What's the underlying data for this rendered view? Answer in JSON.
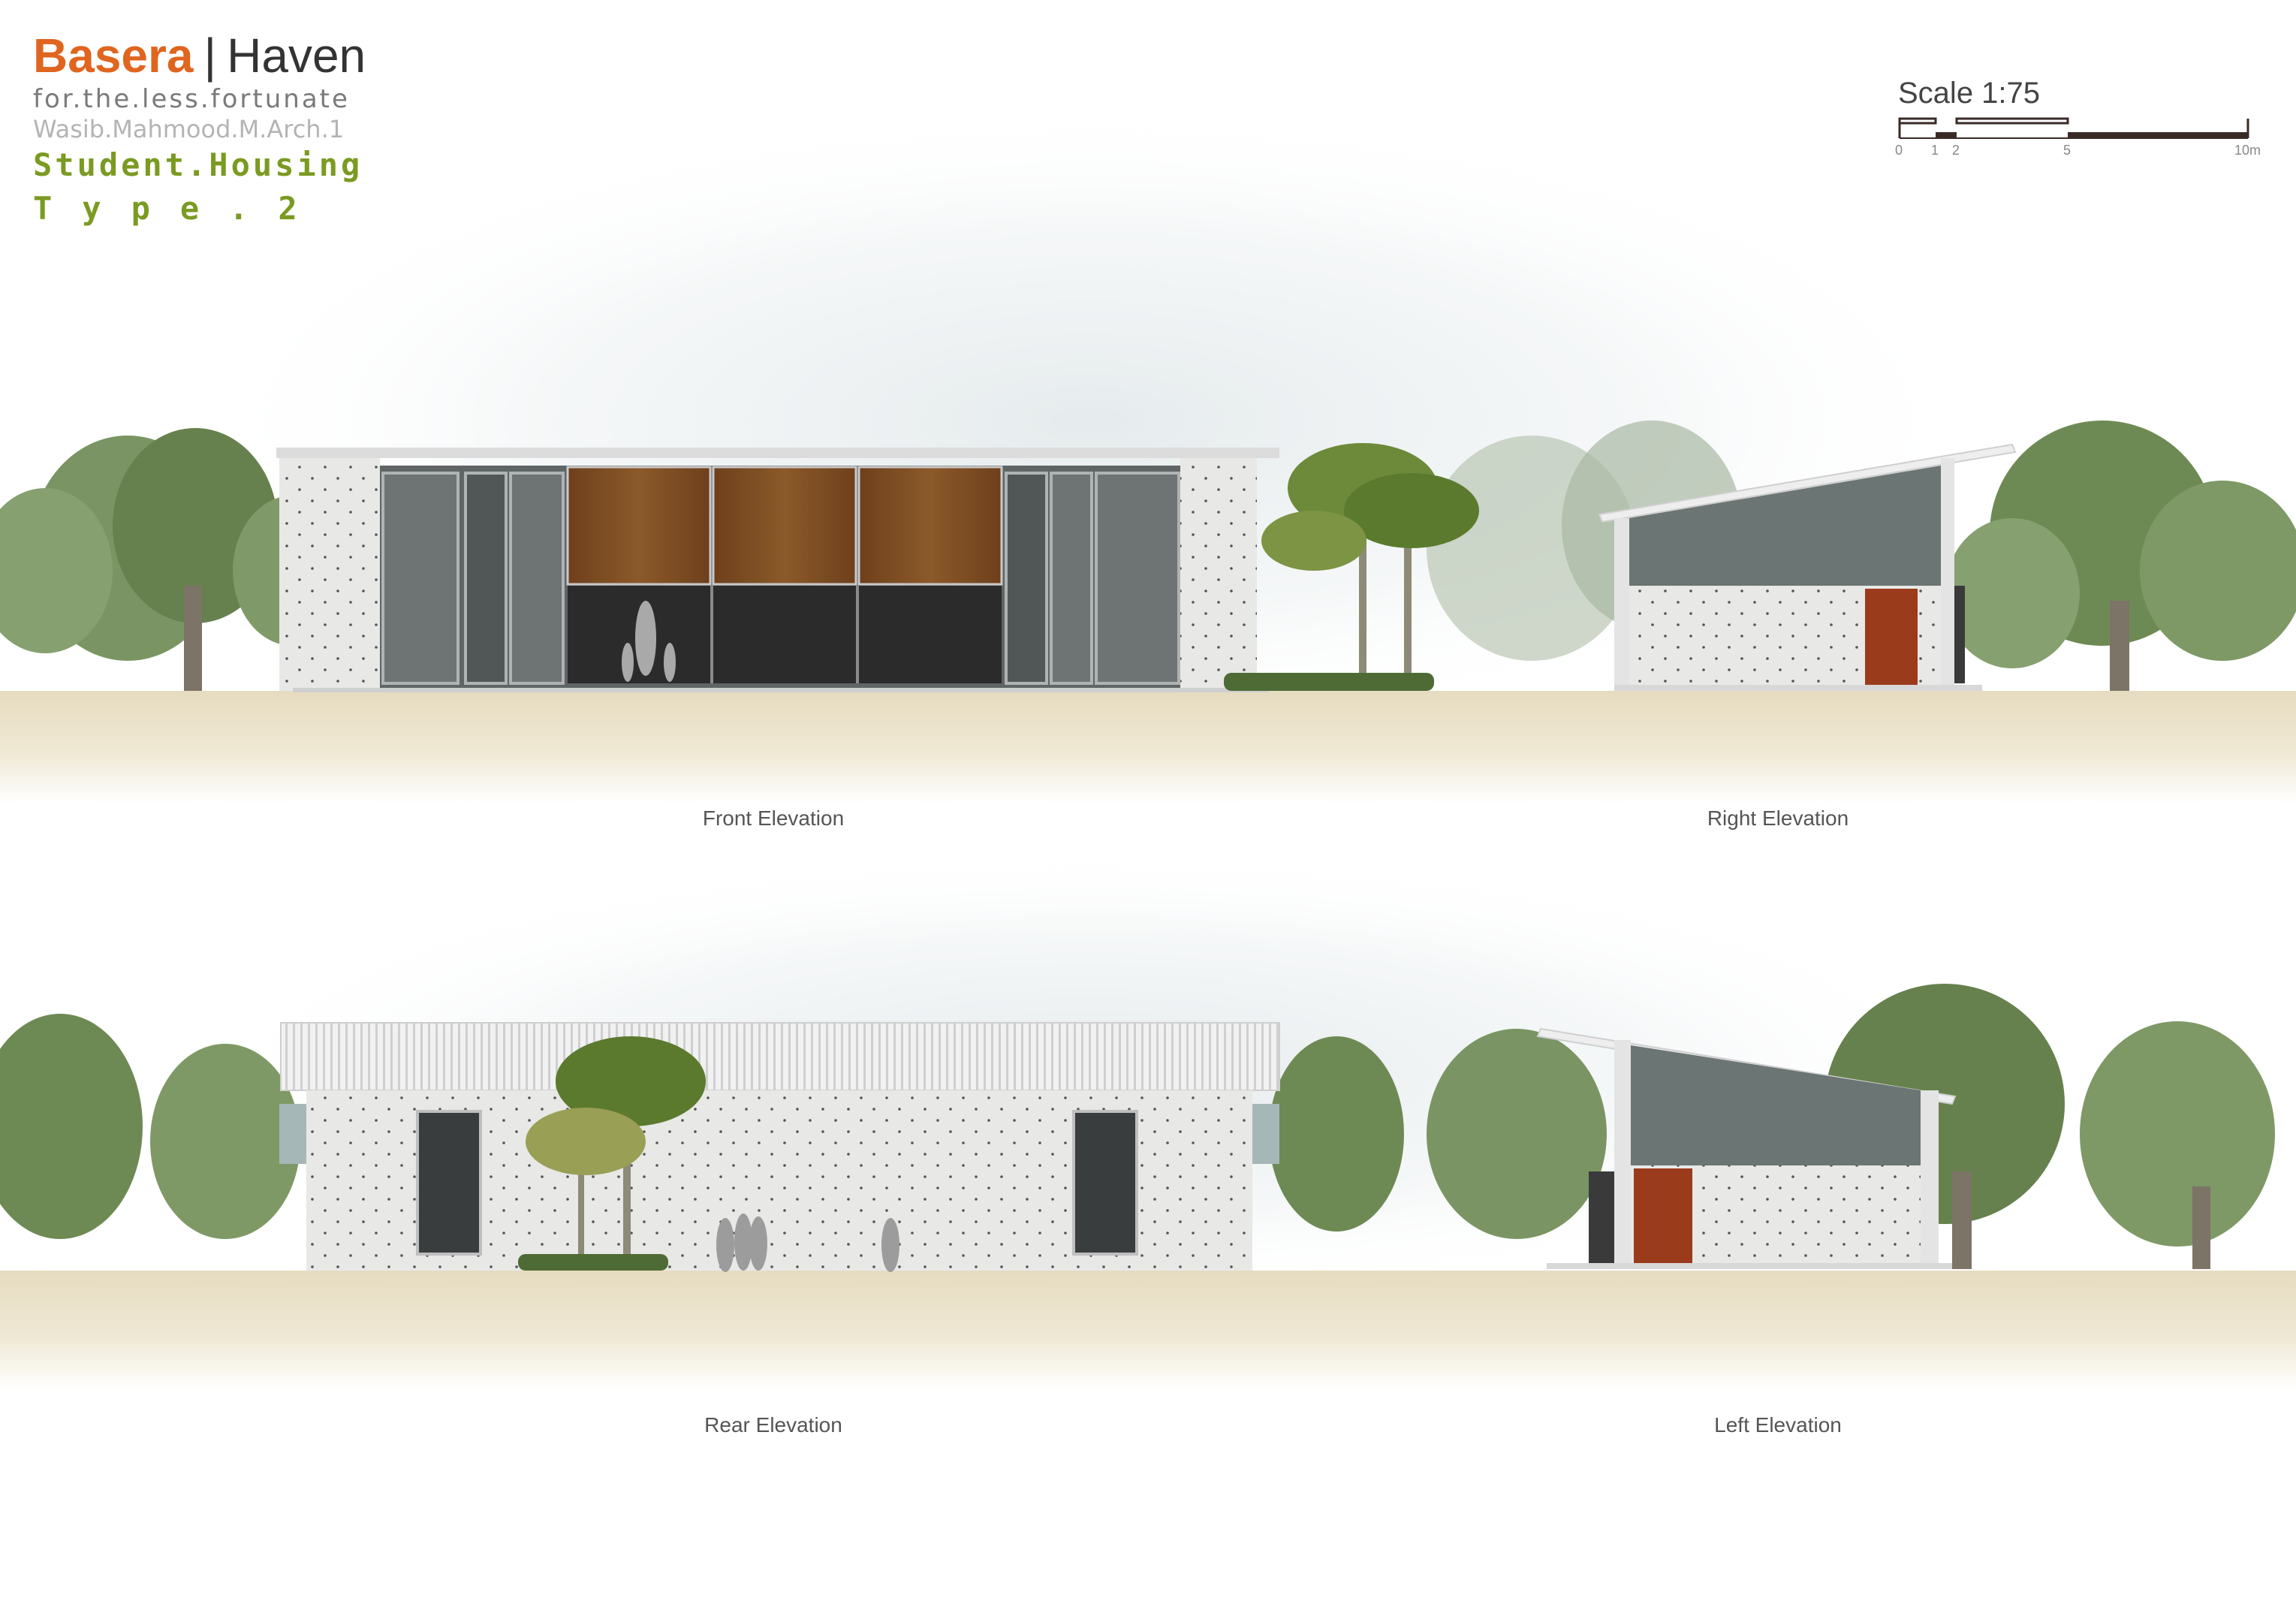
{
  "title": {
    "brand": "Basera",
    "separator": "|",
    "name": "Haven",
    "subtitle": "for.the.less.fortunate",
    "author": "Wasib.Mahmood.M.Arch.1",
    "project": "Student.Housing",
    "type": "Type.2"
  },
  "scale": {
    "label": "Scale 1:75",
    "ticks": [
      "0",
      "1",
      "2",
      "5",
      "10m"
    ]
  },
  "elevations": {
    "front": "Front Elevation",
    "right": "Right Elevation",
    "rear": "Rear Elevation",
    "left": "Left Elevation"
  },
  "colors": {
    "brand_orange": "#e0651f",
    "title_green": "#7b9a22",
    "concrete": "#e6e6e4",
    "glass": "#6b7573",
    "timber": "#7a4a22",
    "rust_door": "#9a3b1c",
    "tree_green": "#6f8a55",
    "ground_sand": "#ece5cf"
  }
}
